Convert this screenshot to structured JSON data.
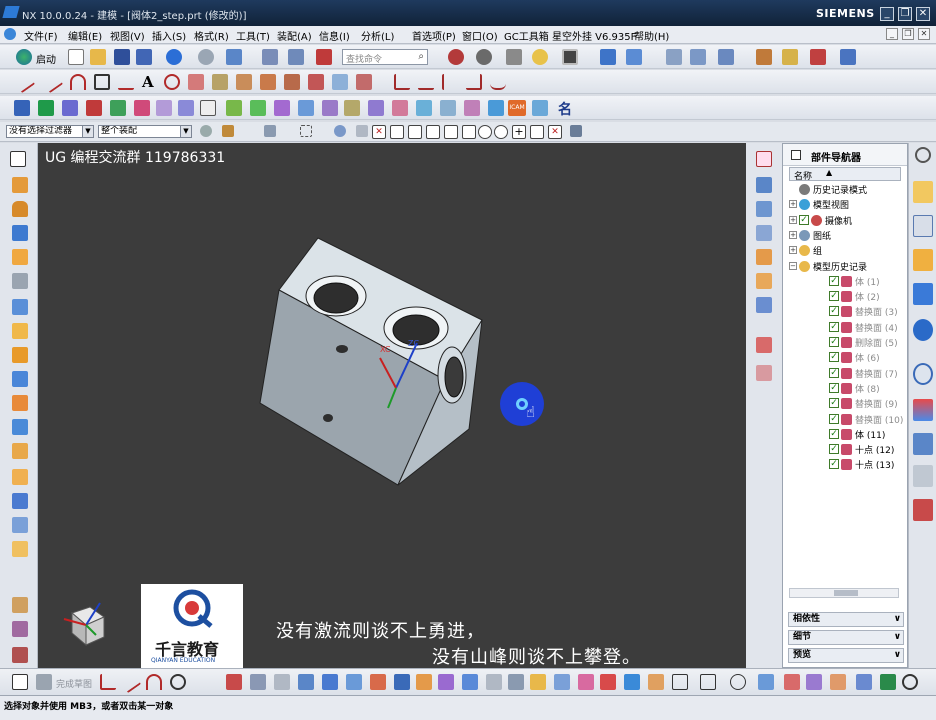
{
  "titlebar": {
    "title": "NX 10.0.0.24 - 建模 - [阀体2_step.prt (修改的)]",
    "brand": "SIEMENS",
    "minimize": "_",
    "restore": "❐",
    "close": "✕"
  },
  "menu": {
    "items": [
      "文件(F)",
      "编辑(E)",
      "视图(V)",
      "插入(S)",
      "格式(R)",
      "工具(T)",
      "装配(A)",
      "信息(I)",
      "分析(L)",
      "首选项(P)",
      "窗口(O)",
      "GC工具箱",
      "星空外挂 V6.935F",
      "帮助(H)"
    ]
  },
  "toolbar1": {
    "start_label": "启动",
    "search_placeholder": "查找命令"
  },
  "filterbar": {
    "filter_value": "没有选择过滤器",
    "scope_value": "整个装配"
  },
  "viewport": {
    "watermark": "UG 编程交流群 119786331",
    "xc_label": "XC",
    "zc_label": "ZC",
    "logo_text": "千言教育",
    "logo_sub": "QIANYAN EDUCATION",
    "subtitle_line1": "没有激流则谈不上勇进，",
    "subtitle_line2": "没有山峰则谈不上攀登。"
  },
  "navigator": {
    "title": "部件导航器",
    "column_header": "名称",
    "rows": [
      {
        "label": "历史记录模式",
        "indent": 0,
        "exp": "",
        "check": false,
        "gray": false
      },
      {
        "label": "模型视图",
        "indent": 0,
        "exp": "+",
        "check": false,
        "gray": false
      },
      {
        "label": "摄像机",
        "indent": 0,
        "exp": "+",
        "check": true,
        "gray": false
      },
      {
        "label": "图纸",
        "indent": 0,
        "exp": "+",
        "check": false,
        "gray": false
      },
      {
        "label": "组",
        "indent": 0,
        "exp": "+",
        "check": false,
        "gray": false
      },
      {
        "label": "模型历史记录",
        "indent": 0,
        "exp": "−",
        "check": false,
        "gray": false
      },
      {
        "label": "体 (1)",
        "indent": 1,
        "exp": "",
        "check": true,
        "gray": true
      },
      {
        "label": "体 (2)",
        "indent": 1,
        "exp": "",
        "check": true,
        "gray": true
      },
      {
        "label": "替换面 (3)",
        "indent": 1,
        "exp": "",
        "check": true,
        "gray": true
      },
      {
        "label": "替换面 (4)",
        "indent": 1,
        "exp": "",
        "check": true,
        "gray": true
      },
      {
        "label": "删除面 (5)",
        "indent": 1,
        "exp": "",
        "check": true,
        "gray": true
      },
      {
        "label": "体 (6)",
        "indent": 1,
        "exp": "",
        "check": true,
        "gray": true
      },
      {
        "label": "替换面 (7)",
        "indent": 1,
        "exp": "",
        "check": true,
        "gray": true
      },
      {
        "label": "体 (8)",
        "indent": 1,
        "exp": "",
        "check": true,
        "gray": true
      },
      {
        "label": "替换面 (9)",
        "indent": 1,
        "exp": "",
        "check": true,
        "gray": true
      },
      {
        "label": "替换面 (10)",
        "indent": 1,
        "exp": "",
        "check": true,
        "gray": true
      },
      {
        "label": "体 (11)",
        "indent": 1,
        "exp": "",
        "check": true,
        "gray": false
      },
      {
        "label": "十点 (12)",
        "indent": 1,
        "exp": "",
        "check": true,
        "gray": false
      },
      {
        "label": "十点 (13)",
        "indent": 1,
        "exp": "",
        "check": true,
        "gray": false
      }
    ],
    "panels": [
      "相依性",
      "细节",
      "预览"
    ]
  },
  "bottombar": {
    "finish_sketch": "完成草图"
  },
  "status": {
    "text": "选择对象并使用 MB3，或者双击某一对象"
  },
  "colors": {
    "titlebar": "#102238",
    "viewport_bg": "#3c3c3c",
    "part": "#b9c4cc",
    "cursor_circle": "#1f3fd6"
  }
}
